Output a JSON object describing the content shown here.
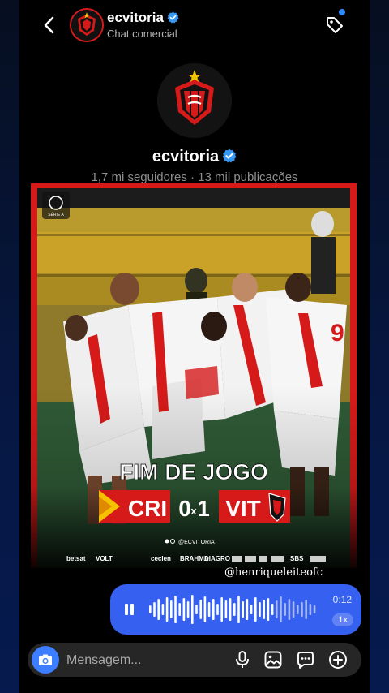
{
  "header": {
    "account_name": "ecvitoria",
    "subtitle": "Chat comercial"
  },
  "profile": {
    "name": "ecvitoria",
    "stats": "1,7 mi seguidores · 13 mil publicações"
  },
  "post": {
    "headline": "FIM DE JOGO",
    "home_team": "CRI",
    "score_home": "0",
    "score_sep": "x",
    "score_away": "1",
    "away_team": "VIT",
    "social_handle": "@ECVITORIA",
    "sponsors": [
      "betsat",
      "VOLT",
      "ceclen",
      "BRAHMA",
      "DIAGRO",
      "SBS"
    ],
    "player_number": "9",
    "competition_mark": "SÉRIE A"
  },
  "watermark_handle": "@henriqueleiteofc",
  "audio_message": {
    "duration": "0:12",
    "speed": "1x"
  },
  "composer": {
    "placeholder": "Mensagem..."
  },
  "icons": {
    "back": "back-arrow-icon",
    "tag": "tag-icon",
    "verified": "verified-badge-icon",
    "camera": "camera-icon",
    "mic": "microphone-icon",
    "gallery": "image-icon",
    "sticker": "sticker-icon",
    "add": "plus-icon",
    "pause": "pause-icon"
  },
  "colors": {
    "accent_blue": "#3560f0",
    "verified_blue": "#3797f0",
    "club_red": "#d61a1a",
    "club_black": "#111111",
    "stands_yellow": "#c9a227"
  }
}
